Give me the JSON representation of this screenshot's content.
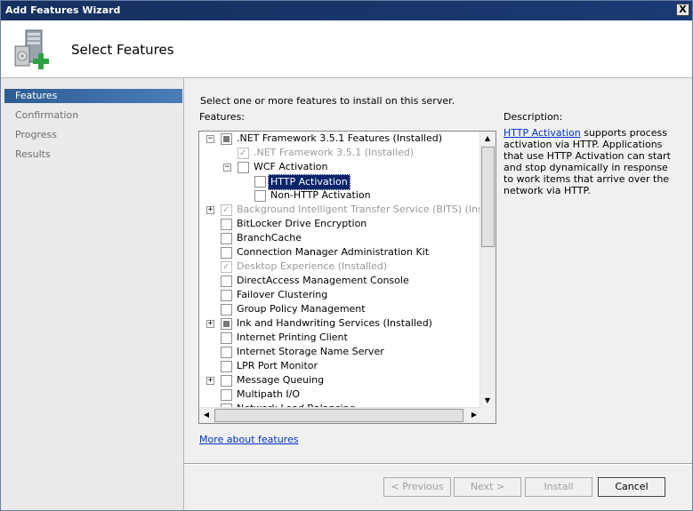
{
  "window": {
    "title": "Add Features Wizard",
    "close_glyph": "X"
  },
  "header": {
    "title": "Select Features"
  },
  "steps": [
    "Features",
    "Confirmation",
    "Progress",
    "Results"
  ],
  "content": {
    "instruction": "Select one or more features to install on this server.",
    "features_label": "Features:",
    "description_label": "Description:",
    "description_link": "HTTP Activation",
    "description_text": " supports process activation via HTTP. Applications that use HTTP Activation can start and stop dynamically in response to work items that arrive over the network via HTTP.",
    "more_link": "More about features"
  },
  "features": [
    {
      "label": ".NET Framework 3.5.1 Features  (Installed)",
      "level": 0,
      "expander": "minus",
      "state": "partial",
      "disabled": false
    },
    {
      "label": ".NET Framework 3.5.1  (Installed)",
      "level": 1,
      "expander": "",
      "state": "checked",
      "disabled": true
    },
    {
      "label": "WCF Activation",
      "level": 1,
      "expander": "minus",
      "state": "unchecked",
      "disabled": false
    },
    {
      "label": "HTTP Activation",
      "level": 2,
      "expander": "",
      "state": "unchecked",
      "disabled": false,
      "selected": true
    },
    {
      "label": "Non-HTTP Activation",
      "level": 2,
      "expander": "",
      "state": "unchecked",
      "disabled": false
    },
    {
      "label": "Background Intelligent Transfer Service (BITS)  (Installed)",
      "level": 0,
      "expander": "plus",
      "state": "checked",
      "disabled": true
    },
    {
      "label": "BitLocker Drive Encryption",
      "level": 0,
      "expander": "",
      "state": "unchecked",
      "disabled": false
    },
    {
      "label": "BranchCache",
      "level": 0,
      "expander": "",
      "state": "unchecked",
      "disabled": false
    },
    {
      "label": "Connection Manager Administration Kit",
      "level": 0,
      "expander": "",
      "state": "unchecked",
      "disabled": false
    },
    {
      "label": "Desktop Experience  (Installed)",
      "level": 0,
      "expander": "",
      "state": "checked",
      "disabled": true
    },
    {
      "label": "DirectAccess Management Console",
      "level": 0,
      "expander": "",
      "state": "unchecked",
      "disabled": false
    },
    {
      "label": "Failover Clustering",
      "level": 0,
      "expander": "",
      "state": "unchecked",
      "disabled": false
    },
    {
      "label": "Group Policy Management",
      "level": 0,
      "expander": "",
      "state": "unchecked",
      "disabled": false
    },
    {
      "label": "Ink and Handwriting Services  (Installed)",
      "level": 0,
      "expander": "plus",
      "state": "partial",
      "disabled": false
    },
    {
      "label": "Internet Printing Client",
      "level": 0,
      "expander": "",
      "state": "unchecked",
      "disabled": false
    },
    {
      "label": "Internet Storage Name Server",
      "level": 0,
      "expander": "",
      "state": "unchecked",
      "disabled": false
    },
    {
      "label": "LPR Port Monitor",
      "level": 0,
      "expander": "",
      "state": "unchecked",
      "disabled": false
    },
    {
      "label": "Message Queuing",
      "level": 0,
      "expander": "plus",
      "state": "unchecked",
      "disabled": false
    },
    {
      "label": "Multipath I/O",
      "level": 0,
      "expander": "",
      "state": "unchecked",
      "disabled": false
    },
    {
      "label": "Network Load Balancing",
      "level": 0,
      "expander": "",
      "state": "unchecked",
      "disabled": false
    }
  ],
  "buttons": {
    "previous": "< Previous",
    "next": "Next >",
    "install": "Install",
    "cancel": "Cancel"
  },
  "colors": {
    "selection": "#0a246a",
    "link": "#0033cc",
    "active_step": "#3b6ea5"
  }
}
